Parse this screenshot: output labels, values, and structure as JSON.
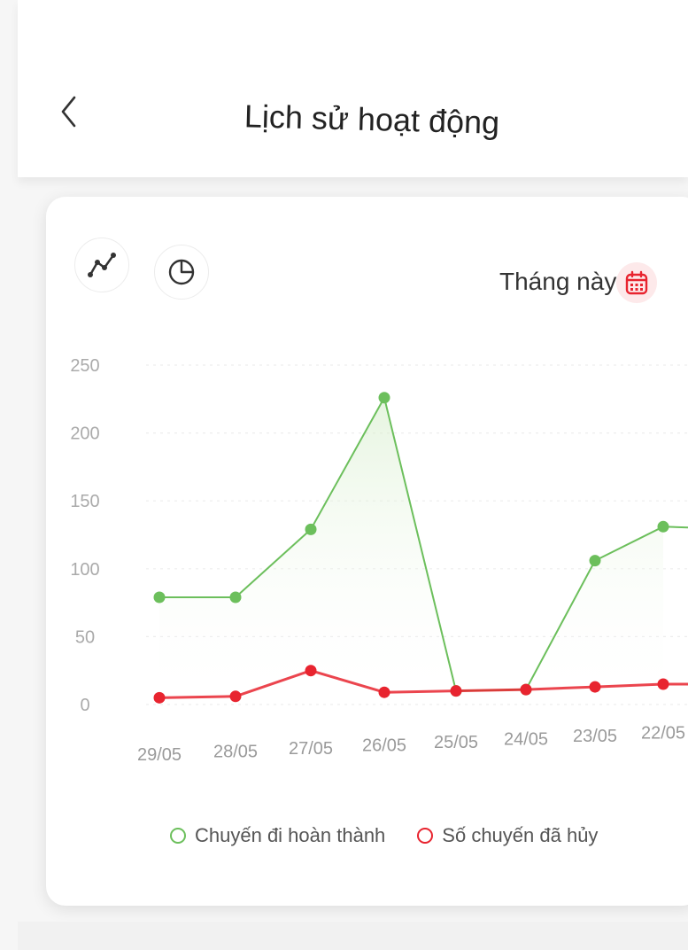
{
  "header": {
    "title": "Lịch sử hoạt động"
  },
  "toolbar": {
    "line_chart_icon": "line-chart-icon",
    "pie_chart_icon": "pie-chart-icon",
    "period_label": "Tháng này",
    "calendar_icon": "calendar-icon"
  },
  "colors": {
    "completed": "#6cbf5c",
    "cancelled": "#e8242f",
    "accent": "#e8242f"
  },
  "chart_data": {
    "type": "line",
    "categories": [
      "29/05",
      "28/05",
      "27/05",
      "26/05",
      "25/05",
      "24/05",
      "23/05",
      "22/05"
    ],
    "series": [
      {
        "name": "Chuyến đi hoàn thành",
        "color": "#6cbf5c",
        "values": [
          79,
          79,
          129,
          226,
          10,
          11,
          106,
          131
        ]
      },
      {
        "name": "Số chuyến đã hủy",
        "color": "#e8242f",
        "values": [
          5,
          6,
          25,
          9,
          10,
          11,
          13,
          15
        ]
      }
    ],
    "yticks": [
      "250",
      "200",
      "150",
      "100",
      "50",
      "0"
    ],
    "ylim": [
      0,
      250
    ],
    "grid": true,
    "legend_position": "bottom"
  }
}
